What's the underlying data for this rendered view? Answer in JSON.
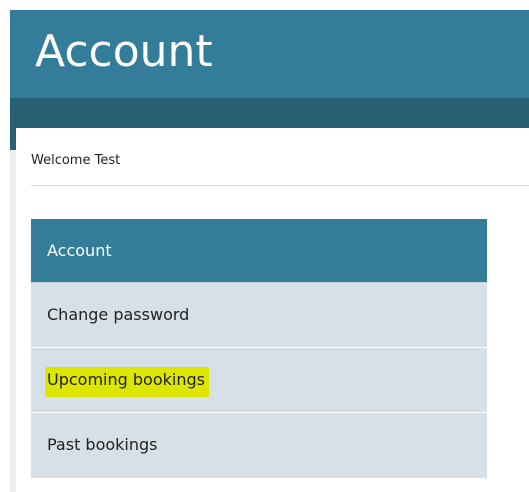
{
  "header": {
    "title": "Account"
  },
  "welcome": {
    "text": "Welcome Test"
  },
  "account_menu": {
    "heading": "Account",
    "items": [
      {
        "label": "Change password",
        "highlighted": false
      },
      {
        "label": "Upcoming bookings",
        "highlighted": true
      },
      {
        "label": "Past bookings",
        "highlighted": false
      }
    ]
  },
  "colors": {
    "header": "#337d9b",
    "subbar": "#275f73",
    "menu_item_bg": "#d7e0e6",
    "highlight": "#dde600"
  }
}
